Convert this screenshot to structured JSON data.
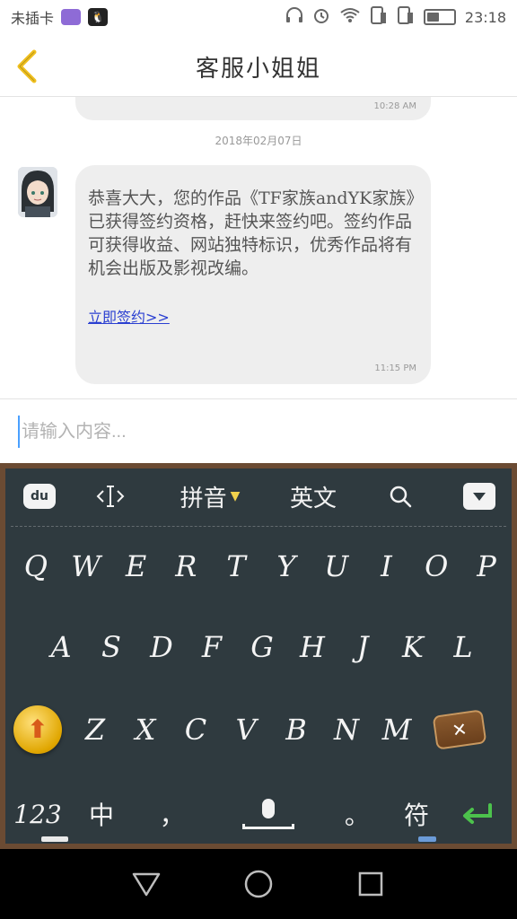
{
  "status_bar": {
    "carrier": "未插卡",
    "time": "23:18",
    "icons": [
      "headphones-icon",
      "alarm-icon",
      "wifi-icon",
      "sim-1-icon",
      "sim-2-icon",
      "battery-icon"
    ],
    "battery_level": 0.45
  },
  "header": {
    "title": "客服小姐姐",
    "back_icon": "chevron-left-icon",
    "accent_color": "#f0c020"
  },
  "chat": {
    "previous_message_time": "10:28 AM",
    "date_separator": "2018年02月07日",
    "message": {
      "text": "恭喜大大，您的作品《TF家族andYK家族》已获得签约资格，赶快来签约吧。签约作品可获得收益、网站独特标识，优秀作品将有机会出版及影视改编。",
      "link_text": "立即签约>>",
      "time": "11:15 PM"
    }
  },
  "input": {
    "placeholder": "请输入内容..."
  },
  "keyboard": {
    "toolbar": {
      "logo": "du",
      "pinyin": "拼音",
      "english": "英文"
    },
    "row1": [
      "Q",
      "W",
      "E",
      "R",
      "T",
      "Y",
      "U",
      "I",
      "O",
      "P"
    ],
    "row2": [
      "A",
      "S",
      "D",
      "F",
      "G",
      "H",
      "J",
      "K",
      "L"
    ],
    "row3": [
      "Z",
      "X",
      "C",
      "V",
      "B",
      "N",
      "M"
    ],
    "bottom": {
      "numbers": "123",
      "chinese": "中",
      "comma": "，",
      "period": "。",
      "symbol": "符"
    },
    "colors": {
      "board": "#2f3a3f",
      "frame": "#6b4b33",
      "highlight": "#f1d24c",
      "enter": "#4cc24c"
    }
  },
  "nav": {
    "icons": [
      "back-triangle-icon",
      "home-circle-icon",
      "recents-square-icon"
    ]
  }
}
